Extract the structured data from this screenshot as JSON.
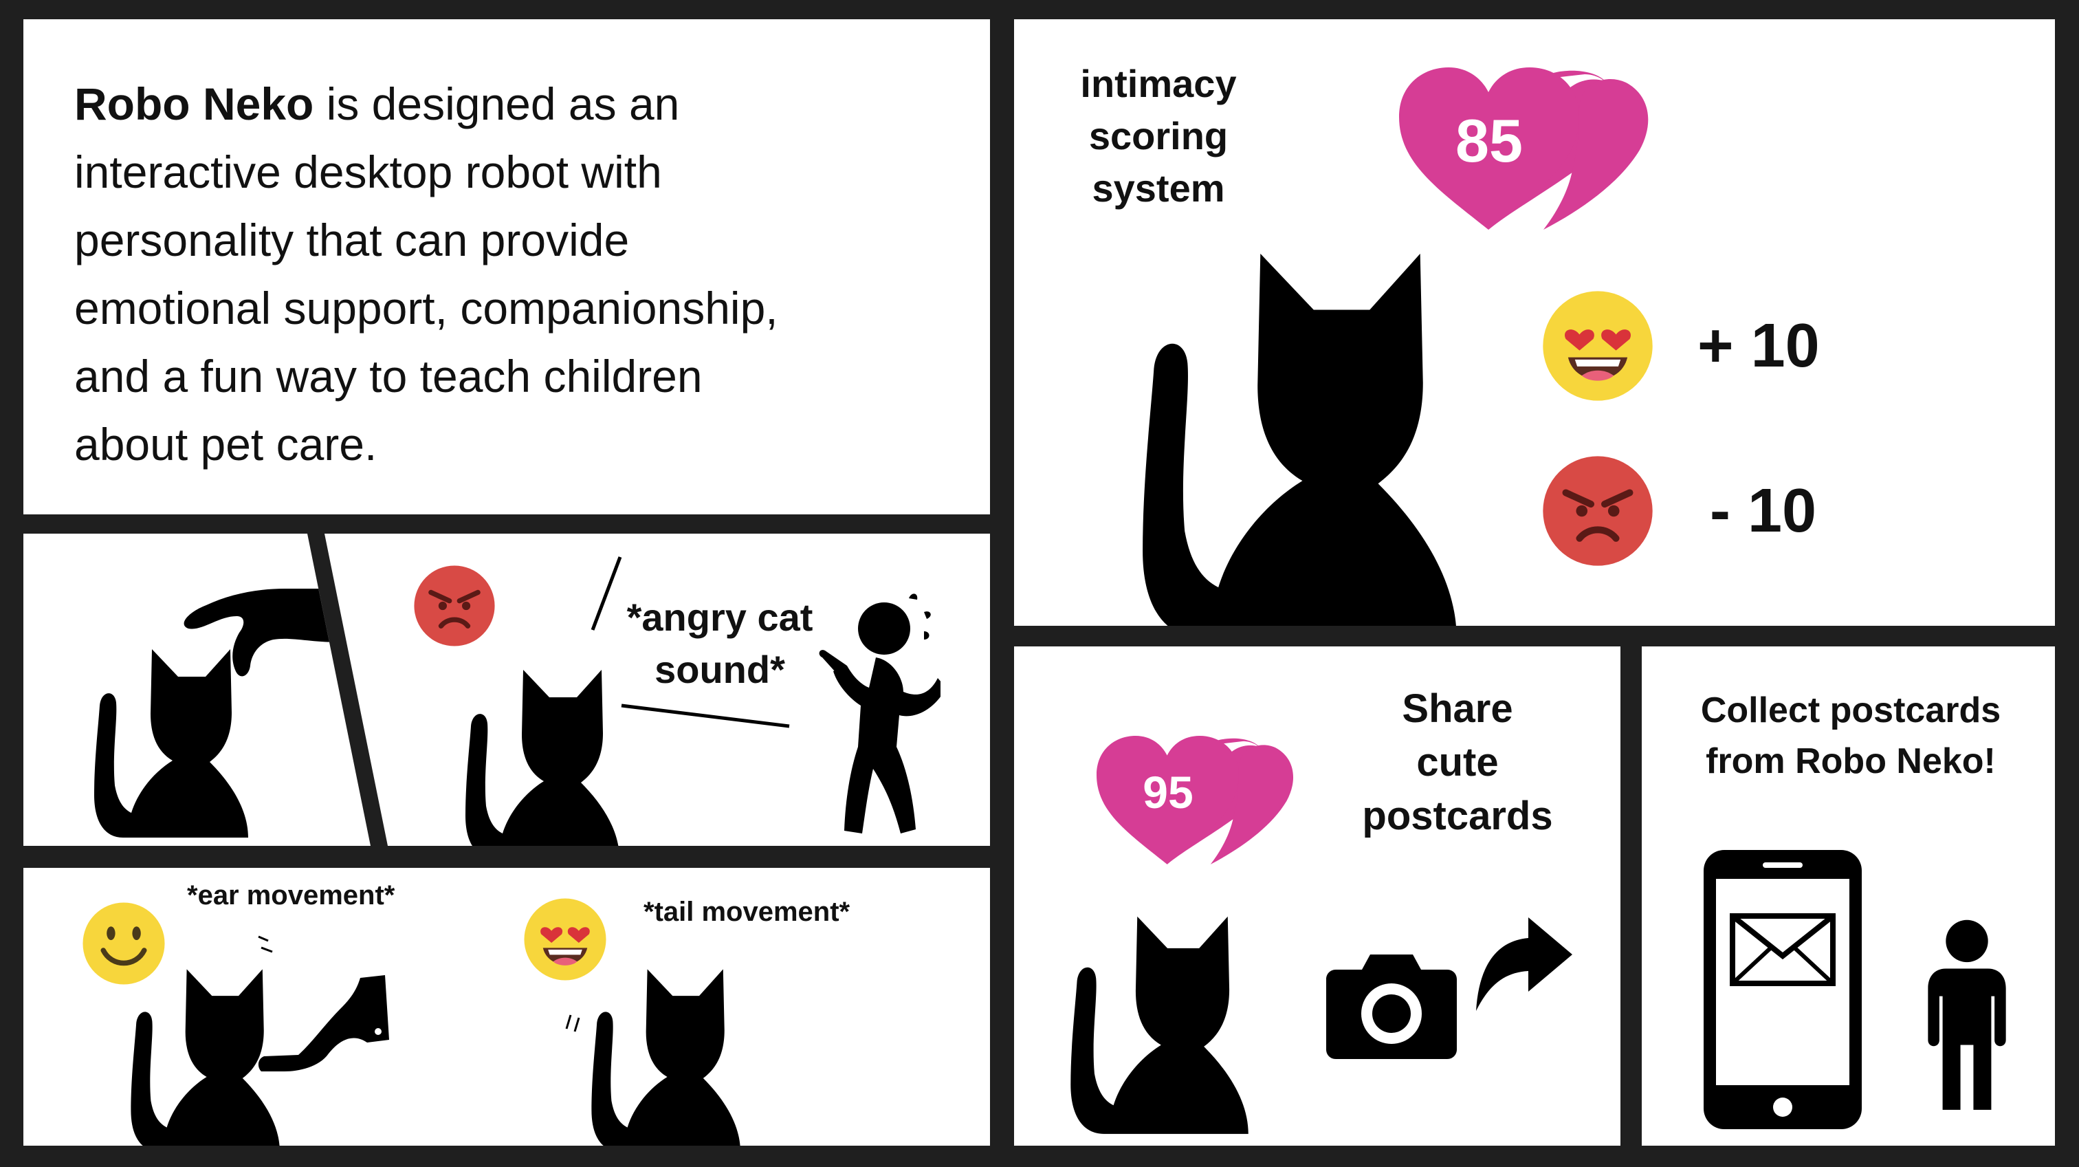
{
  "intro": {
    "brand": "Robo Neko",
    "lines": [
      " is designed as an",
      "interactive desktop robot with",
      "personality that can provide",
      "emotional support, companionship,",
      "and a fun way to teach children",
      "about pet care."
    ]
  },
  "intimacy": {
    "label_lines": [
      "intimacy",
      "scoring",
      "system"
    ],
    "score": "85",
    "plus": "+ 10",
    "minus": "- 10"
  },
  "angry_panel": {
    "sound_line1": "*angry cat",
    "sound_line2": "sound*"
  },
  "ear_panel": {
    "caption": "*ear movement*"
  },
  "tail_panel": {
    "caption": "*tail movement*"
  },
  "share_panel": {
    "score": "95",
    "label_lines": [
      "Share",
      "cute",
      "postcards"
    ]
  },
  "collect_panel": {
    "label_lines": [
      "Collect postcards",
      "from Robo Neko!"
    ]
  },
  "colors": {
    "background": "#1f1f1f",
    "heart": "#d63d95",
    "angry": "#d84a45",
    "happy": "#f7d63c"
  },
  "icons": [
    "cat-silhouette",
    "heart-icon",
    "heart-eyes-emoji",
    "angry-emoji",
    "smile-emoji",
    "hand-icon",
    "person-icon",
    "camera-icon",
    "share-arrow-icon",
    "smartphone-icon",
    "envelope-icon"
  ]
}
